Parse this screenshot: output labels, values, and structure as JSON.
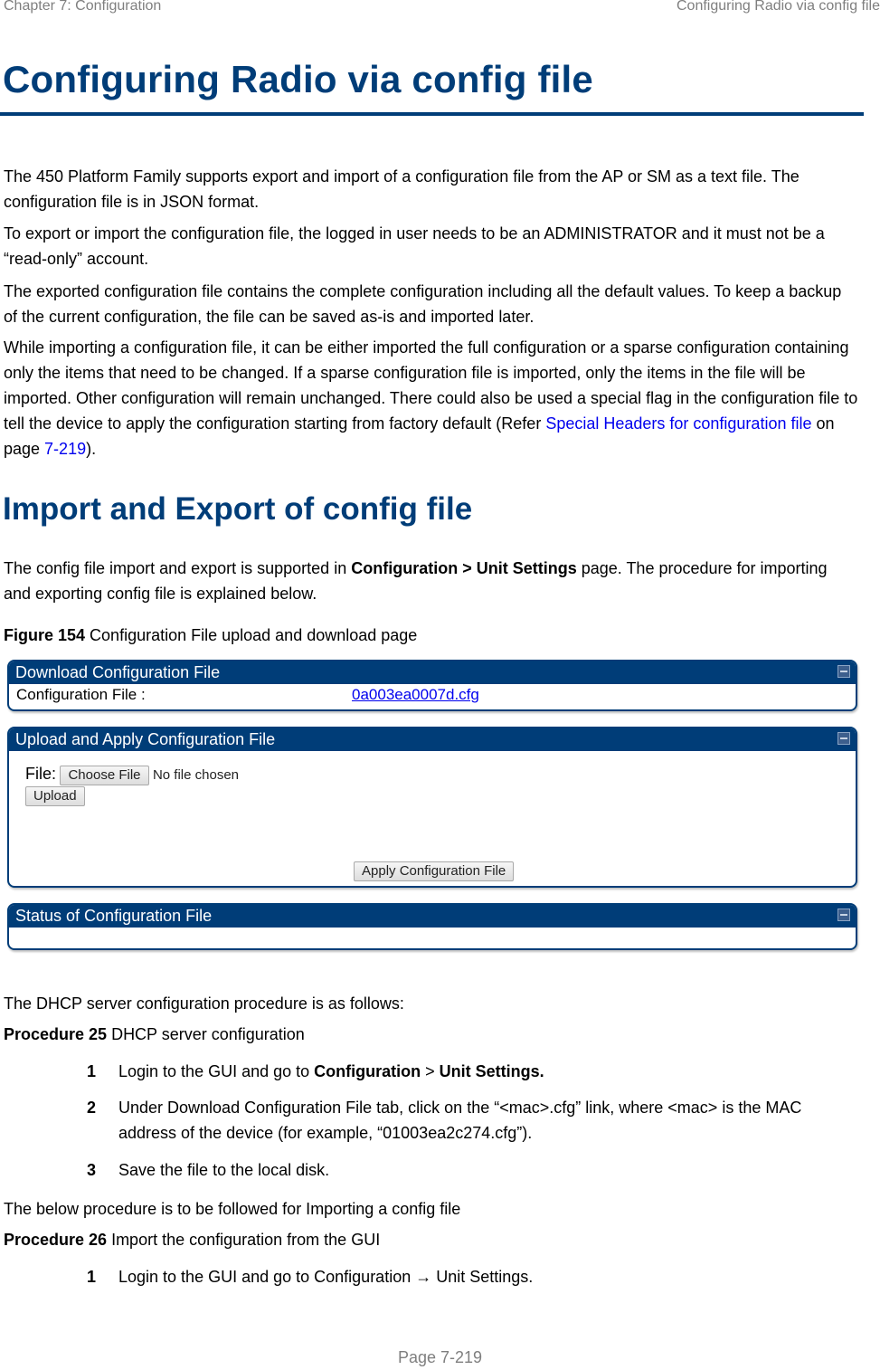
{
  "running_header": {
    "left": "Chapter 7:  Configuration",
    "right": "Configuring Radio via config file"
  },
  "title": "Configuring Radio via config file",
  "intro_paragraphs": [
    "The 450 Platform Family supports export and import of a configuration file from the AP or SM as a text file. The configuration file is in JSON format.",
    "To export or import the configuration file, the logged in user needs to be an ADMINISTRATOR and it must not be a “read-only” account.",
    "The exported configuration file contains the complete configuration including all the default values. To keep a backup of the current configuration, the file can be saved as-is and imported later."
  ],
  "sparse_paragraph": {
    "text": "While importing a configuration file, it can be either imported the full configuration or a sparse configuration containing only the items that need to be changed. If a sparse configuration file is imported, only the items in the file will be imported. Other configuration will remain unchanged. There could also be used a special flag in the configuration file to tell the device to apply the configuration starting from factory default (Refer ",
    "link_text": "Special Headers for configuration file",
    "mid_text": " on page ",
    "page_link": "7-219",
    "end_text": ")."
  },
  "section_title": "Import and Export of config file",
  "section_paragraph": {
    "pre": "The config file import and export is supported in ",
    "bold": "Configuration > Unit Settings",
    "post": " page. The procedure for importing and exporting config file is explained below."
  },
  "figure": {
    "label": "Figure 154",
    "caption": " Configuration File upload and download page",
    "download_panel": {
      "title": "Download Configuration File",
      "row_label": "Configuration File :",
      "file_link": "0a003ea0007d.cfg"
    },
    "upload_panel": {
      "title": "Upload and Apply Configuration File",
      "file_label": "File:",
      "choose_button": "Choose File",
      "no_file_text": "No file chosen",
      "upload_button": "Upload",
      "apply_button": "Apply Configuration File"
    },
    "status_panel": {
      "title": "Status of Configuration File"
    }
  },
  "dhcp_intro": "The DHCP server configuration procedure is as follows:",
  "procedure25": {
    "label": "Procedure 25",
    "title": " DHCP server configuration",
    "steps": [
      {
        "num": "1",
        "pre": "Login to the GUI and go to ",
        "b1": "Configuration",
        "mid": " > ",
        "b2": "Unit Settings."
      },
      {
        "num": "2",
        "text": "Under Download Configuration File tab, click on the “<mac>.cfg” link, where <mac> is the MAC address of the device (for example, “01003ea2c274.cfg”)."
      },
      {
        "num": "3",
        "text": "Save the file to the local disk."
      }
    ]
  },
  "import_intro": "The below procedure is to be followed for Importing a config file",
  "procedure26": {
    "label": "Procedure 26",
    "title": " Import the configuration from the GUI",
    "steps": [
      {
        "num": "1",
        "text": "Login to the GUI and go to Configuration → Unit Settings."
      }
    ]
  },
  "footer": "Page 7-219"
}
